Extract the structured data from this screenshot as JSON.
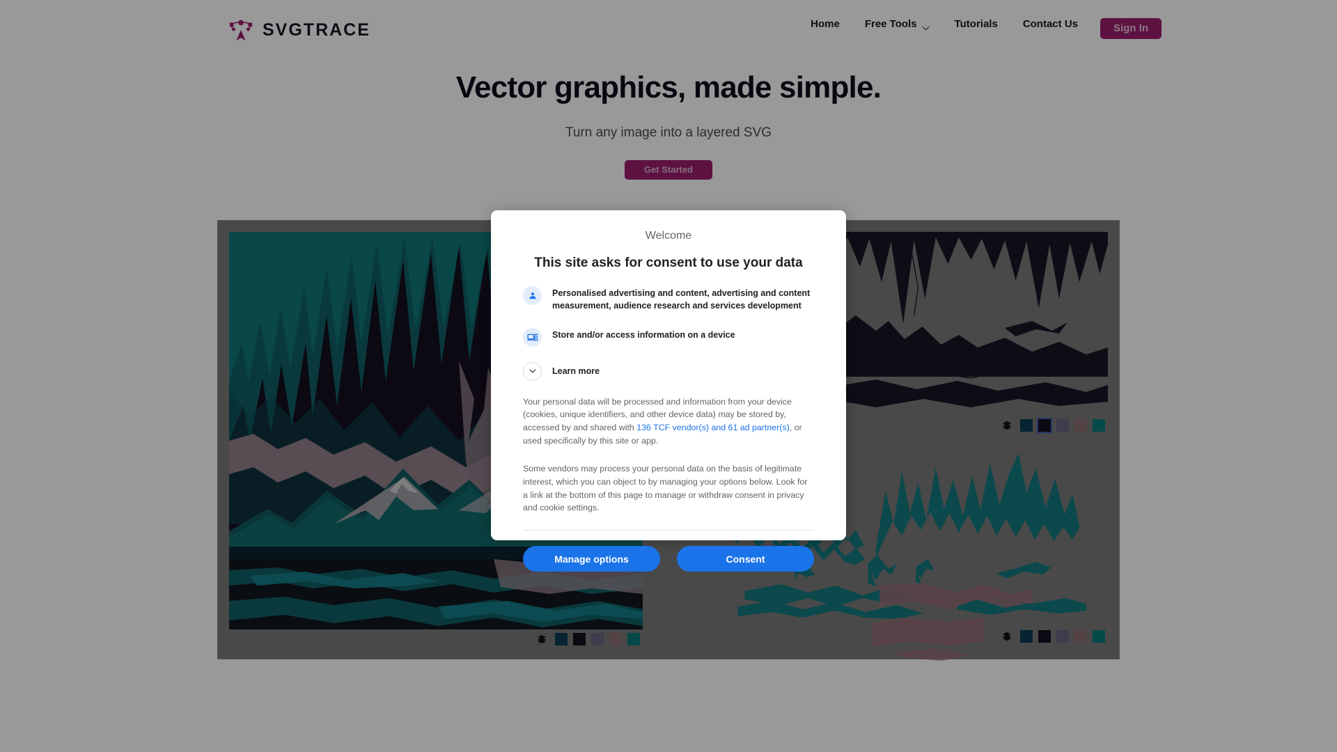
{
  "site": {
    "brand": {
      "name": "SVGTRACE",
      "icon": "svgtrace-node-logo",
      "color": "#9c1e6e"
    },
    "nav": {
      "links": [
        {
          "label": "Home",
          "icon": null
        },
        {
          "label": "Free Tools",
          "icon": "chevron-down-icon"
        },
        {
          "label": "Tutorials",
          "icon": null
        },
        {
          "label": "Contact Us",
          "icon": null
        }
      ],
      "sign_in_label": "Sign In"
    },
    "hero": {
      "headline": "Vector graphics, made simple.",
      "subhead": "Turn any image into a layered SVG",
      "cta_label": "Get Started"
    },
    "gallery": {
      "layers_icon": "layers-stack-icon",
      "palette": [
        "#0b3d52",
        "#150f20",
        "#6b6581",
        "#8e6e72",
        "#0b7b7b"
      ],
      "panels": [
        {
          "name": "full-composite",
          "selected_swatch": null,
          "layers_icon": "layers-stack-icon"
        },
        {
          "name": "mauve-layer",
          "selected_swatch": null,
          "layers_icon": "layers-stack-icon"
        },
        {
          "name": "dark-layer",
          "selected_swatch": 1,
          "layers_icon": "layers-stack-icon"
        },
        {
          "name": "teal-layer",
          "selected_swatch": null,
          "layers_icon": "layers-stack-icon"
        }
      ]
    }
  },
  "consent": {
    "welcome": "Welcome",
    "title": "This site asks for consent to use your data",
    "purposes": [
      {
        "icon": "person-icon",
        "text": "Personalised advertising and content, advertising and content measurement, audience research and services development"
      },
      {
        "icon": "devices-icon",
        "text": "Store and/or access information on a device"
      }
    ],
    "learn_more": {
      "icon": "chevron-down-circle-icon",
      "label": "Learn more"
    },
    "paragraph_1_before": "Your personal data will be processed and information from your device (cookies, unique identifiers, and other device data) may be stored by, accessed by and shared with ",
    "paragraph_1_link": "136 TCF vendor(s) and 61 ad partner(s)",
    "paragraph_1_after": ", or used specifically by this site or app.",
    "paragraph_2": "Some vendors may process your personal data on the basis of legitimate interest, which you can object to by managing your options below. Look for a link at the bottom of this page to manage or withdraw consent in privacy and cookie settings.",
    "buttons": {
      "manage": "Manage options",
      "consent": "Consent"
    },
    "accent": "#1a73e8"
  }
}
